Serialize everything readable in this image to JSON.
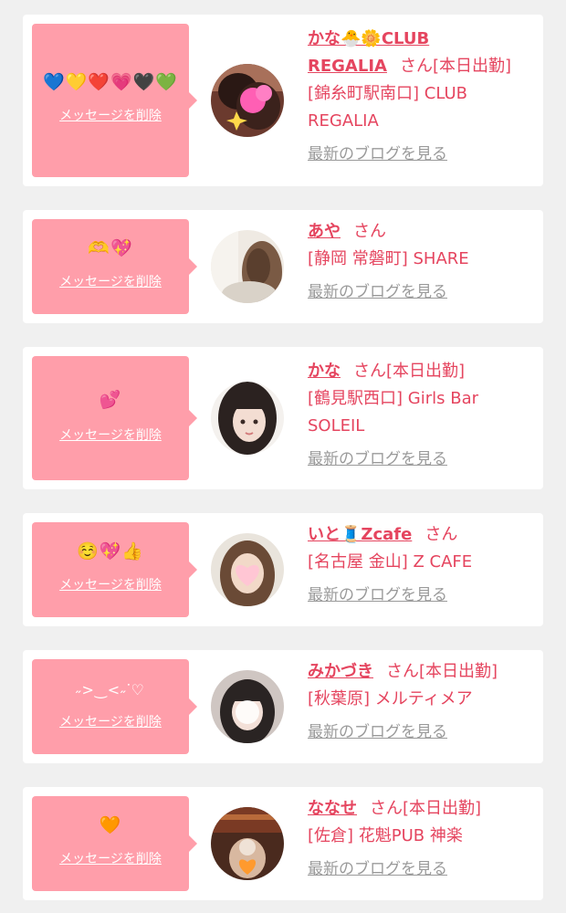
{
  "colors": {
    "page_bg": "#f0f0f0",
    "card_bg": "#ffffff",
    "bubble_pink": "#ff9eaa",
    "accent_red": "#e5455f",
    "link_gray": "#9a9a9a"
  },
  "labels": {
    "delete": "メッセージを削除",
    "blog": "最新のブログを見る",
    "san": "さん"
  },
  "items": [
    {
      "message": "💙💛❤️💗🖤💚",
      "name_line1": "かな🐣🌼CLUB",
      "name_line2": "REGALIA",
      "status": "[本日出勤]",
      "shop": "[錦糸町駅南口] CLUB REGALIA"
    },
    {
      "message": "🫶💖",
      "name_line1": "あや",
      "name_line2": "",
      "status": "",
      "shop": "[静岡 常磐町] SHARE"
    },
    {
      "message": "💕",
      "name_line1": "かな",
      "name_line2": "",
      "status": "[本日出勤]",
      "shop": "[鶴見駅西口] Girls Bar SOLEIL"
    },
    {
      "message": "☺️💖👍",
      "name_line1": "いと🧵Zcafe",
      "name_line2": "",
      "status": "",
      "shop": "[名古屋 金山] Z CAFE"
    },
    {
      "message": "˶>‿<˶ᐝ♡",
      "name_line1": "みかづき",
      "name_line2": "",
      "status": "[本日出勤]",
      "shop": "[秋葉原] メルティメア"
    },
    {
      "message": "🧡",
      "name_line1": "ななせ",
      "name_line2": "",
      "status": "[本日出勤]",
      "shop": "[佐倉] 花魁PUB 神楽"
    }
  ]
}
